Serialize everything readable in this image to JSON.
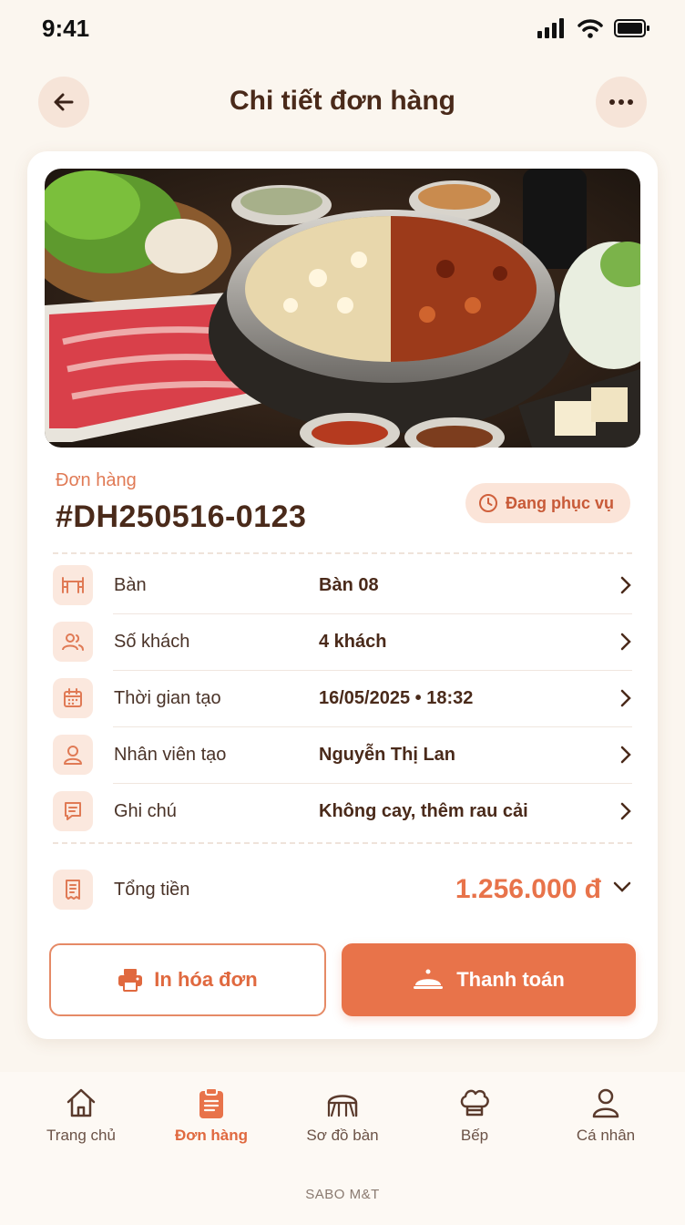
{
  "status_bar": {
    "time": "9:41"
  },
  "header": {
    "title": "Chi tiết đơn hàng"
  },
  "order": {
    "caption": "Đơn hàng",
    "id": "#DH250516-0123",
    "status": "Đang phục vụ"
  },
  "details": [
    {
      "label": "Bàn",
      "value": "Bàn 08",
      "icon": "table-icon"
    },
    {
      "label": "Số khách",
      "value": "4 khách",
      "icon": "guests-icon"
    },
    {
      "label": "Thời gian tạo",
      "value": "16/05/2025 • 18:32",
      "icon": "calendar-icon"
    },
    {
      "label": "Nhân viên tạo",
      "value": "Nguyễn Thị Lan",
      "icon": "user-icon"
    },
    {
      "label": "Ghi chú",
      "value": "Không cay, thêm rau cải",
      "icon": "note-icon"
    }
  ],
  "total": {
    "label": "Tổng tiền",
    "value": "1.256.000 đ"
  },
  "actions": {
    "print": "In hóa đơn",
    "pay": "Thanh toán"
  },
  "nav": {
    "items": [
      {
        "label": "Trang chủ",
        "icon": "home-icon"
      },
      {
        "label": "Đơn hàng",
        "icon": "clipboard-icon",
        "active": true
      },
      {
        "label": "Sơ đồ bàn",
        "icon": "floor-plan-icon"
      },
      {
        "label": "Bếp",
        "icon": "chef-hat-icon"
      },
      {
        "label": "Cá nhân",
        "icon": "profile-icon"
      }
    ],
    "brand": "SABO M&T"
  },
  "colors": {
    "accent": "#e8734a",
    "background": "#fbf6ef",
    "text": "#4a2a1a"
  }
}
